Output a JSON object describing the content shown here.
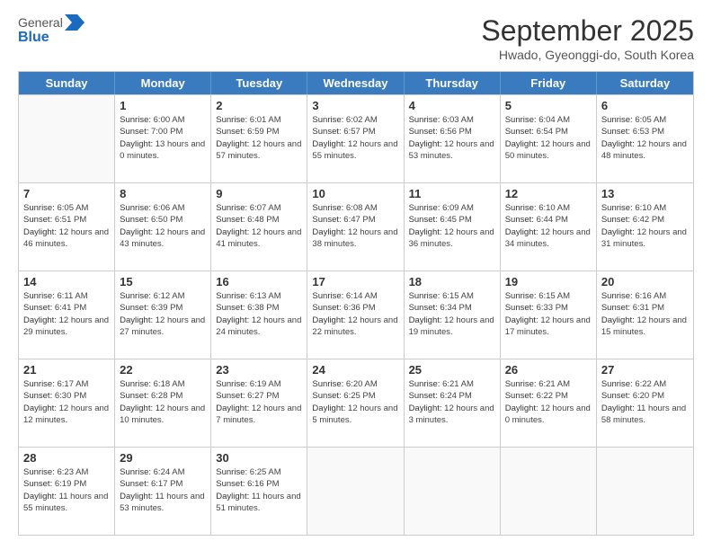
{
  "header": {
    "logo_line1": "General",
    "logo_line2": "Blue",
    "month_title": "September 2025",
    "subtitle": "Hwado, Gyeonggi-do, South Korea"
  },
  "days_of_week": [
    "Sunday",
    "Monday",
    "Tuesday",
    "Wednesday",
    "Thursday",
    "Friday",
    "Saturday"
  ],
  "weeks": [
    [
      {
        "day": "",
        "empty": true
      },
      {
        "day": "1",
        "sunrise": "6:00 AM",
        "sunset": "7:00 PM",
        "daylight": "13 hours and 0 minutes."
      },
      {
        "day": "2",
        "sunrise": "6:01 AM",
        "sunset": "6:59 PM",
        "daylight": "12 hours and 57 minutes."
      },
      {
        "day": "3",
        "sunrise": "6:02 AM",
        "sunset": "6:57 PM",
        "daylight": "12 hours and 55 minutes."
      },
      {
        "day": "4",
        "sunrise": "6:03 AM",
        "sunset": "6:56 PM",
        "daylight": "12 hours and 53 minutes."
      },
      {
        "day": "5",
        "sunrise": "6:04 AM",
        "sunset": "6:54 PM",
        "daylight": "12 hours and 50 minutes."
      },
      {
        "day": "6",
        "sunrise": "6:05 AM",
        "sunset": "6:53 PM",
        "daylight": "12 hours and 48 minutes."
      }
    ],
    [
      {
        "day": "7",
        "sunrise": "6:05 AM",
        "sunset": "6:51 PM",
        "daylight": "12 hours and 46 minutes."
      },
      {
        "day": "8",
        "sunrise": "6:06 AM",
        "sunset": "6:50 PM",
        "daylight": "12 hours and 43 minutes."
      },
      {
        "day": "9",
        "sunrise": "6:07 AM",
        "sunset": "6:48 PM",
        "daylight": "12 hours and 41 minutes."
      },
      {
        "day": "10",
        "sunrise": "6:08 AM",
        "sunset": "6:47 PM",
        "daylight": "12 hours and 38 minutes."
      },
      {
        "day": "11",
        "sunrise": "6:09 AM",
        "sunset": "6:45 PM",
        "daylight": "12 hours and 36 minutes."
      },
      {
        "day": "12",
        "sunrise": "6:10 AM",
        "sunset": "6:44 PM",
        "daylight": "12 hours and 34 minutes."
      },
      {
        "day": "13",
        "sunrise": "6:10 AM",
        "sunset": "6:42 PM",
        "daylight": "12 hours and 31 minutes."
      }
    ],
    [
      {
        "day": "14",
        "sunrise": "6:11 AM",
        "sunset": "6:41 PM",
        "daylight": "12 hours and 29 minutes."
      },
      {
        "day": "15",
        "sunrise": "6:12 AM",
        "sunset": "6:39 PM",
        "daylight": "12 hours and 27 minutes."
      },
      {
        "day": "16",
        "sunrise": "6:13 AM",
        "sunset": "6:38 PM",
        "daylight": "12 hours and 24 minutes."
      },
      {
        "day": "17",
        "sunrise": "6:14 AM",
        "sunset": "6:36 PM",
        "daylight": "12 hours and 22 minutes."
      },
      {
        "day": "18",
        "sunrise": "6:15 AM",
        "sunset": "6:34 PM",
        "daylight": "12 hours and 19 minutes."
      },
      {
        "day": "19",
        "sunrise": "6:15 AM",
        "sunset": "6:33 PM",
        "daylight": "12 hours and 17 minutes."
      },
      {
        "day": "20",
        "sunrise": "6:16 AM",
        "sunset": "6:31 PM",
        "daylight": "12 hours and 15 minutes."
      }
    ],
    [
      {
        "day": "21",
        "sunrise": "6:17 AM",
        "sunset": "6:30 PM",
        "daylight": "12 hours and 12 minutes."
      },
      {
        "day": "22",
        "sunrise": "6:18 AM",
        "sunset": "6:28 PM",
        "daylight": "12 hours and 10 minutes."
      },
      {
        "day": "23",
        "sunrise": "6:19 AM",
        "sunset": "6:27 PM",
        "daylight": "12 hours and 7 minutes."
      },
      {
        "day": "24",
        "sunrise": "6:20 AM",
        "sunset": "6:25 PM",
        "daylight": "12 hours and 5 minutes."
      },
      {
        "day": "25",
        "sunrise": "6:21 AM",
        "sunset": "6:24 PM",
        "daylight": "12 hours and 3 minutes."
      },
      {
        "day": "26",
        "sunrise": "6:21 AM",
        "sunset": "6:22 PM",
        "daylight": "12 hours and 0 minutes."
      },
      {
        "day": "27",
        "sunrise": "6:22 AM",
        "sunset": "6:20 PM",
        "daylight": "11 hours and 58 minutes."
      }
    ],
    [
      {
        "day": "28",
        "sunrise": "6:23 AM",
        "sunset": "6:19 PM",
        "daylight": "11 hours and 55 minutes."
      },
      {
        "day": "29",
        "sunrise": "6:24 AM",
        "sunset": "6:17 PM",
        "daylight": "11 hours and 53 minutes."
      },
      {
        "day": "30",
        "sunrise": "6:25 AM",
        "sunset": "6:16 PM",
        "daylight": "11 hours and 51 minutes."
      },
      {
        "day": "",
        "empty": true
      },
      {
        "day": "",
        "empty": true
      },
      {
        "day": "",
        "empty": true
      },
      {
        "day": "",
        "empty": true
      }
    ]
  ],
  "labels": {
    "sunrise": "Sunrise:",
    "sunset": "Sunset:",
    "daylight": "Daylight:"
  }
}
